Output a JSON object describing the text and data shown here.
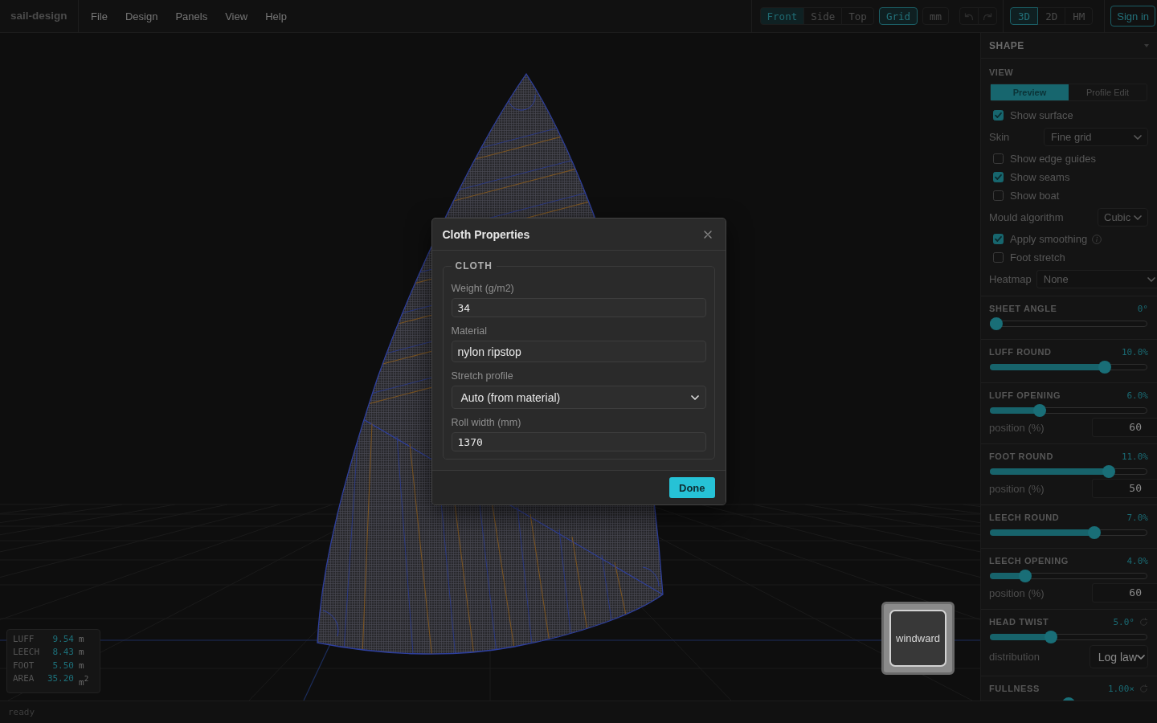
{
  "app": {
    "title": "sail-design",
    "menu": [
      "File",
      "Design",
      "Panels",
      "View",
      "Help"
    ]
  },
  "toolbar": {
    "views": [
      {
        "label": "Front",
        "selected": true
      },
      {
        "label": "Side",
        "selected": false
      },
      {
        "label": "Top",
        "selected": false
      }
    ],
    "toggles": [
      {
        "label": "Grid",
        "on": true
      },
      {
        "label": "mm",
        "on": false
      }
    ],
    "history": [
      {
        "kind": "undo",
        "disabled": true
      },
      {
        "kind": "redo",
        "disabled": true
      }
    ],
    "modes": [
      {
        "label": "3D",
        "selected": true
      },
      {
        "label": "2D",
        "selected": false
      },
      {
        "label": "HM",
        "selected": false
      }
    ],
    "account": {
      "label": "Sign in"
    }
  },
  "viewport": {
    "view_cube": {
      "label": "windward"
    },
    "stats": [
      {
        "label": "LUFF",
        "value": "9.54",
        "unit": "m"
      },
      {
        "label": "LEECH",
        "value": "8.43",
        "unit": "m"
      },
      {
        "label": "FOOT",
        "value": "5.50",
        "unit": "m"
      },
      {
        "label": "AREA",
        "value": "35.20",
        "unit": "m$^{2}$"
      }
    ]
  },
  "panel": {
    "title": "SHAPE",
    "view": {
      "heading": "VIEW",
      "tabs": [
        {
          "label": "Preview",
          "selected": true
        },
        {
          "label": "Profile Edit",
          "selected": false
        }
      ],
      "options": [
        {
          "kind": "checkbox",
          "label": "Show surface",
          "checked": true
        },
        {
          "kind": "select",
          "label": "Skin",
          "value": "Fine grid"
        },
        {
          "kind": "checkbox",
          "label": "Show edge guides",
          "checked": false
        },
        {
          "kind": "checkbox",
          "label": "Show seams",
          "checked": true
        },
        {
          "kind": "checkbox",
          "label": "Show boat",
          "checked": false
        },
        {
          "kind": "select",
          "label": "Mould algorithm",
          "value": "Cubic"
        },
        {
          "kind": "checkbox",
          "label": "Apply smoothing",
          "checked": true,
          "info": true
        },
        {
          "kind": "checkbox",
          "label": "Foot stretch",
          "checked": false
        },
        {
          "kind": "select",
          "label": "Heatmap",
          "value": "None"
        }
      ]
    },
    "sliders": [
      {
        "label": "SHEET ANGLE",
        "reading": "0°",
        "level": 0,
        "resettable": false
      },
      {
        "label": "LUFF ROUND",
        "reading": "10.0%",
        "level": 0.75,
        "resettable": false
      },
      {
        "label": "LUFF OPENING",
        "reading": "6.0%",
        "level": 0.3,
        "resettable": false,
        "extra": {
          "kind": "number",
          "label": "position (%)",
          "value": "60"
        }
      },
      {
        "label": "FOOT ROUND",
        "reading": "11.0%",
        "level": 0.78,
        "resettable": false,
        "extra": {
          "kind": "number",
          "label": "position (%)",
          "value": "50"
        }
      },
      {
        "label": "LEECH ROUND",
        "reading": "7.0%",
        "level": 0.68,
        "resettable": false
      },
      {
        "label": "LEECH OPENING",
        "reading": "4.0%",
        "level": 0.2,
        "resettable": false,
        "extra": {
          "kind": "number",
          "label": "position (%)",
          "value": "60"
        }
      },
      {
        "label": "HEAD TWIST",
        "reading": "5.0°",
        "level": 0.38,
        "resettable": true,
        "extra": {
          "kind": "select",
          "label": "distribution",
          "value": "Log law"
        }
      },
      {
        "label": "FULLNESS",
        "reading": "1.00×",
        "level": 0.5,
        "resettable": true
      }
    ]
  },
  "modal": {
    "title": "Cloth Properties",
    "group": "CLOTH",
    "fields": [
      {
        "kind": "number",
        "label": "Weight (g/m2)",
        "value": "34"
      },
      {
        "kind": "text",
        "label": "Material",
        "value": "nylon ripstop"
      },
      {
        "kind": "select",
        "label": "Stretch profile",
        "value": "Auto (from material)"
      },
      {
        "kind": "number",
        "label": "Roll width (mm)",
        "value": "1370"
      }
    ],
    "actions": [
      {
        "label": "Done"
      }
    ]
  },
  "status_bar": {
    "text": "ready"
  }
}
